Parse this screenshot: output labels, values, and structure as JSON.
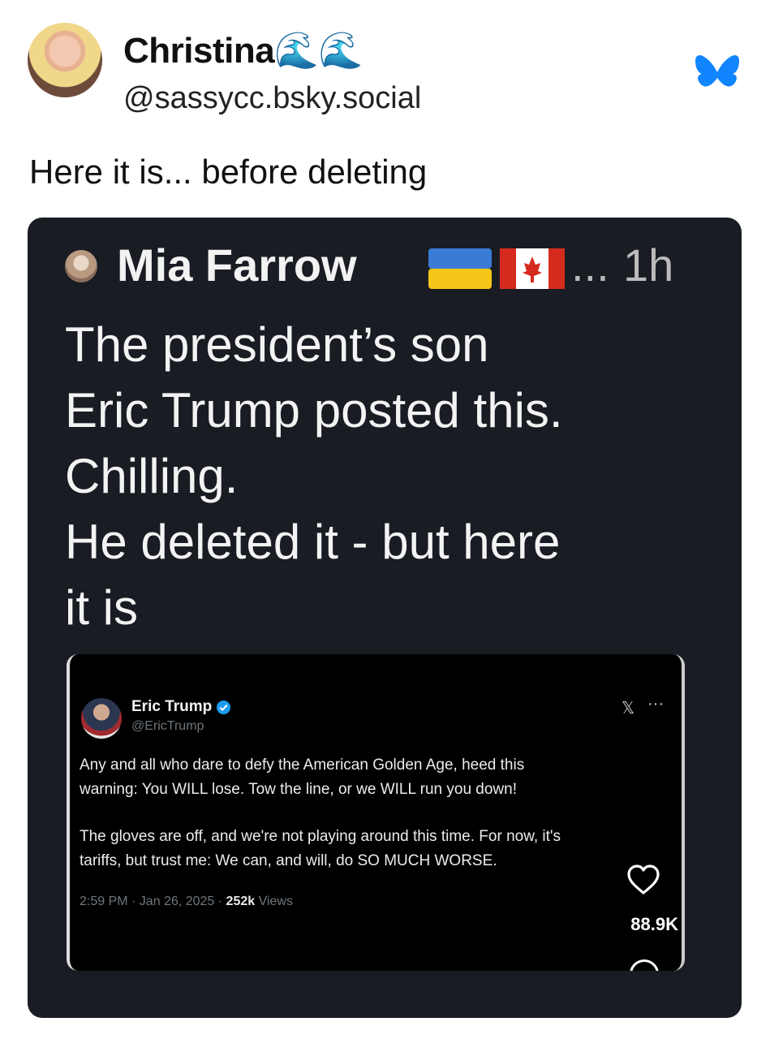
{
  "post": {
    "display_name": "Christina🌊🌊",
    "handle": "@sassycc.bsky.social",
    "text": "Here it is... before deleting",
    "brand_icon": "butterfly-icon",
    "brand_color": "#1185fe"
  },
  "screenshot": {
    "author": "Mia Farrow",
    "flags": [
      "ukraine-flag",
      "canada-flag"
    ],
    "ellipsis": "...",
    "time": "1h",
    "body_lines": [
      "The president’s son",
      "Eric Trump posted this.",
      "Chilling.",
      "He deleted it - but here",
      "it is"
    ],
    "tweet": {
      "name": "Eric Trump",
      "handle": "@EricTrump",
      "x_glyph": "𝕏",
      "more": "···",
      "paragraph1": [
        "Any and all who dare to defy the American Golden Age, heed this",
        "warning: You WILL lose. Tow the line, or we WILL run you down!"
      ],
      "paragraph2": [
        "The gloves are off, and we're not playing around this time. For now, it's",
        "tariffs, but trust me: We can, and will, do SO MUCH WORSE."
      ],
      "timestamp": "2:59 PM · Jan 26, 2025 · ",
      "views_count": "252k",
      "views_label": " Views",
      "likes": "88.9K"
    }
  }
}
